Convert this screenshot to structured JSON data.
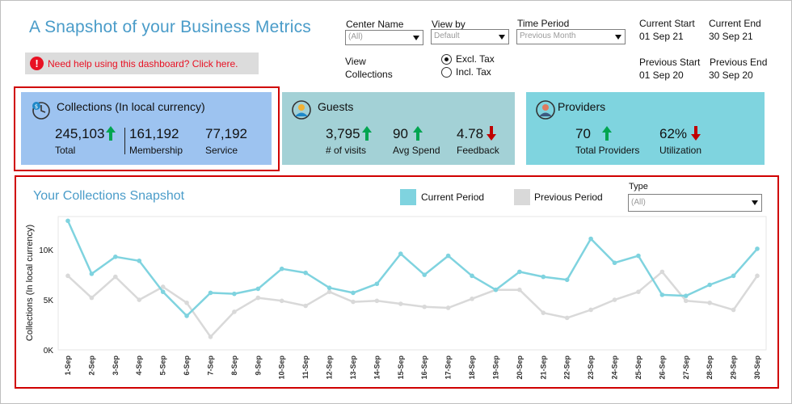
{
  "title": "A Snapshot of your Business Metrics",
  "help_text": "Need help using  this dashboard?  Click  here.",
  "filters": {
    "center_name": {
      "label": "Center  Name",
      "value": "(All)"
    },
    "view_by": {
      "label": "View by",
      "value": "Default"
    },
    "time_period": {
      "label": "Time Period",
      "value": "Previous Month"
    },
    "view_collections_label_1": "View",
    "view_collections_label_2": "Collections",
    "excl_tax": "Excl. Tax",
    "incl_tax": "Incl. Tax",
    "selected_tax": "excl"
  },
  "dates": {
    "current_start_label": "Current Start",
    "current_start": "01 Sep 21",
    "current_end_label": "Current End",
    "current_end": "30 Sep 21",
    "previous_start_label": "Previous Start",
    "previous_start": "01 Sep 20",
    "previous_end_label": "Previous End",
    "previous_end": "30 Sep 20"
  },
  "cards": {
    "collections": {
      "title": "Collections (In local currency)",
      "total_value": "245,103",
      "total_label": "Total",
      "membership_value": "161,192",
      "membership_label": "Membership",
      "service_value": "77,192",
      "service_label": "Service",
      "total_trend": "up"
    },
    "guests": {
      "title": "Guests",
      "visits_value": "3,795",
      "visits_label": "# of visits",
      "spend_value": "90",
      "spend_label": "Avg Spend",
      "feedback_value": "4.78",
      "feedback_label": "Feedback",
      "visits_trend": "up",
      "spend_trend": "up",
      "feedback_trend": "down"
    },
    "providers": {
      "title": "Providers",
      "total_value": "70",
      "total_label": "Total Providers",
      "util_value": "62%",
      "util_label": "Utilization",
      "total_trend": "up",
      "util_trend": "down"
    }
  },
  "colors": {
    "title_blue": "#4a9cc9",
    "card_collections": "#9dc3f0",
    "card_guests": "#a3d1d6",
    "card_providers": "#7fd4df",
    "up_green": "#00a550",
    "down_red": "#c00000",
    "current_series": "#7fd3df",
    "previous_series": "#d9d9d9",
    "highlight_red": "#d00000"
  },
  "chart_section": {
    "title": "Your Collections Snapshot",
    "type_label": "Type",
    "type_value": "(All)"
  },
  "chart_data": {
    "type": "line",
    "xlabel": "",
    "ylabel": "Collections (In local currency)",
    "ylim": [
      0,
      13000
    ],
    "yticks": [
      0,
      5000,
      10000
    ],
    "ytick_labels": [
      "0K",
      "5K",
      "10K"
    ],
    "grid": false,
    "legend": "top",
    "categories": [
      "1-Sep",
      "2-Sep",
      "3-Sep",
      "4-Sep",
      "5-Sep",
      "6-Sep",
      "7-Sep",
      "8-Sep",
      "9-Sep",
      "10-Sep",
      "11-Sep",
      "12-Sep",
      "13-Sep",
      "14-Sep",
      "15-Sep",
      "16-Sep",
      "17-Sep",
      "18-Sep",
      "19-Sep",
      "20-Sep",
      "21-Sep",
      "22-Sep",
      "23-Sep",
      "24-Sep",
      "25-Sep",
      "26-Sep",
      "27-Sep",
      "28-Sep",
      "29-Sep",
      "30-Sep"
    ],
    "series": [
      {
        "name": "Current Period",
        "values": [
          12900,
          7600,
          9300,
          8900,
          5800,
          3400,
          5700,
          5600,
          6100,
          8100,
          7700,
          6200,
          5700,
          6600,
          9600,
          7500,
          9400,
          7400,
          6000,
          7800,
          7300,
          7000,
          11100,
          8700,
          9400,
          5500,
          5400,
          6500,
          7400,
          10100
        ]
      },
      {
        "name": "Previous Period",
        "values": [
          7400,
          5200,
          7300,
          5000,
          6300,
          4700,
          1300,
          3800,
          5200,
          4900,
          4400,
          5800,
          4800,
          4900,
          4600,
          4300,
          4200,
          5100,
          6000,
          6000,
          3700,
          3200,
          4000,
          5000,
          5800,
          7800,
          4900,
          4700,
          4000,
          7400
        ]
      }
    ]
  }
}
